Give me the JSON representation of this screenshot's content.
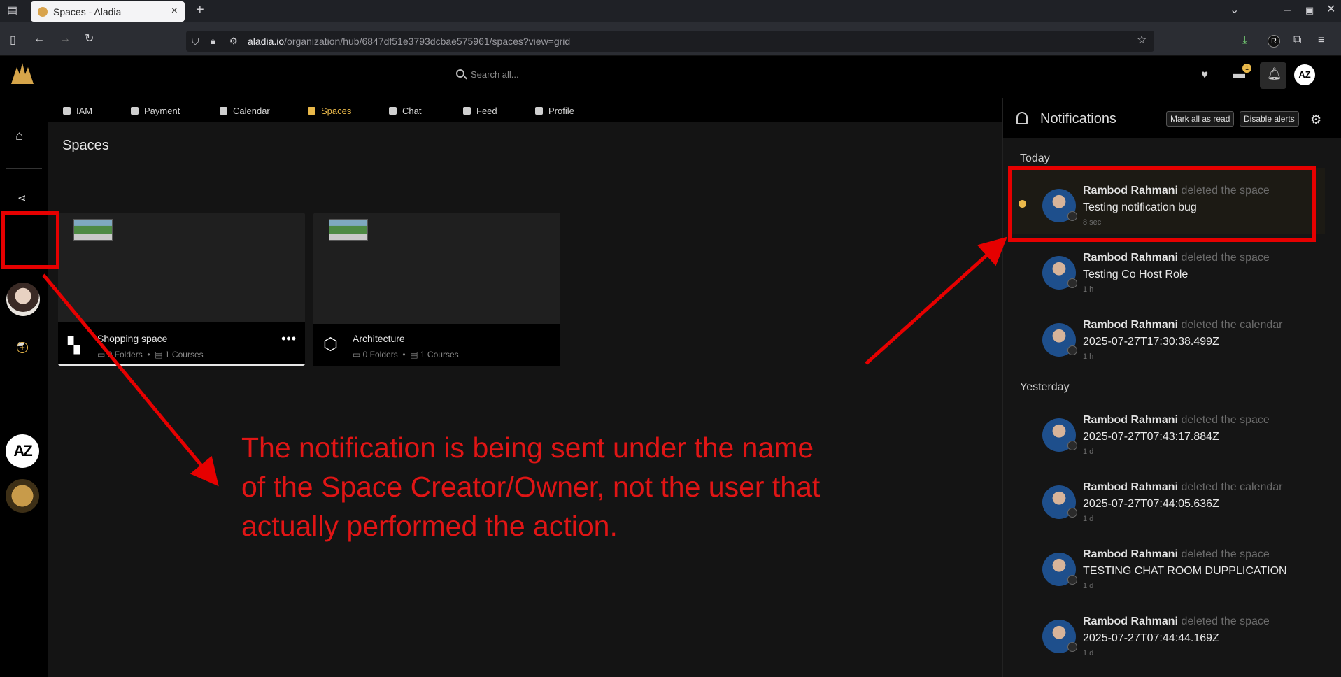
{
  "browser": {
    "tab_title": "Spaces - Aladia",
    "url_host": "aladia.io",
    "url_path": "/organization/hub/6847df51e3793dcbae575961/spaces?view=grid",
    "profile_initial": "R"
  },
  "app": {
    "search_placeholder": "Search all...",
    "message_badge": "1",
    "avatar_text": "AZ",
    "nav_tabs": [
      {
        "label": "IAM",
        "icon": "user-icon"
      },
      {
        "label": "Payment",
        "icon": "card-icon"
      },
      {
        "label": "Calendar",
        "icon": "calendar-icon"
      },
      {
        "label": "Spaces",
        "icon": "spaces-icon",
        "active": true
      },
      {
        "label": "Chat",
        "icon": "chat-icon"
      },
      {
        "label": "Feed",
        "icon": "share-icon"
      },
      {
        "label": "Profile",
        "icon": "profile-icon"
      }
    ],
    "page_title": "Spaces",
    "cards": [
      {
        "title": "Shopping space",
        "folders": "0 Folders",
        "courses": "1 Courses",
        "selected": true
      },
      {
        "title": "Architecture",
        "folders": "0 Folders",
        "courses": "1 Courses",
        "selected": false
      }
    ]
  },
  "annotation": "The notification is being sent under the name of the Space Creator/Owner, not the user that actually performed the action.",
  "notifications": {
    "title": "Notifications",
    "mark_all_label": "Mark all as read",
    "disable_label": "Disable alerts",
    "groups": [
      {
        "label": "Today",
        "items": [
          {
            "name": "Rambod Rahmani",
            "action": "deleted the space",
            "object": "Testing notification bug",
            "time": "8 sec",
            "unread": true
          },
          {
            "name": "Rambod Rahmani",
            "action": "deleted the space",
            "object": "Testing Co Host Role",
            "time": "1 h",
            "unread": false
          },
          {
            "name": "Rambod Rahmani",
            "action": "deleted the calendar",
            "object": "2025-07-27T17:30:38.499Z",
            "time": "1 h",
            "unread": false
          }
        ]
      },
      {
        "label": "Yesterday",
        "items": [
          {
            "name": "Rambod Rahmani",
            "action": "deleted the space",
            "object": "2025-07-27T07:43:17.884Z",
            "time": "1 d",
            "unread": false
          },
          {
            "name": "Rambod Rahmani",
            "action": "deleted the calendar",
            "object": "2025-07-27T07:44:05.636Z",
            "time": "1 d",
            "unread": false
          },
          {
            "name": "Rambod Rahmani",
            "action": "deleted the space",
            "object": "TESTING CHAT ROOM DUPPLICATION",
            "time": "1 d",
            "unread": false
          },
          {
            "name": "Rambod Rahmani",
            "action": "deleted the space",
            "object": "2025-07-27T07:44:44.169Z",
            "time": "1 d",
            "unread": false
          }
        ]
      }
    ]
  },
  "colors": {
    "accent": "#e9b84a",
    "annotation": "#e01515"
  }
}
